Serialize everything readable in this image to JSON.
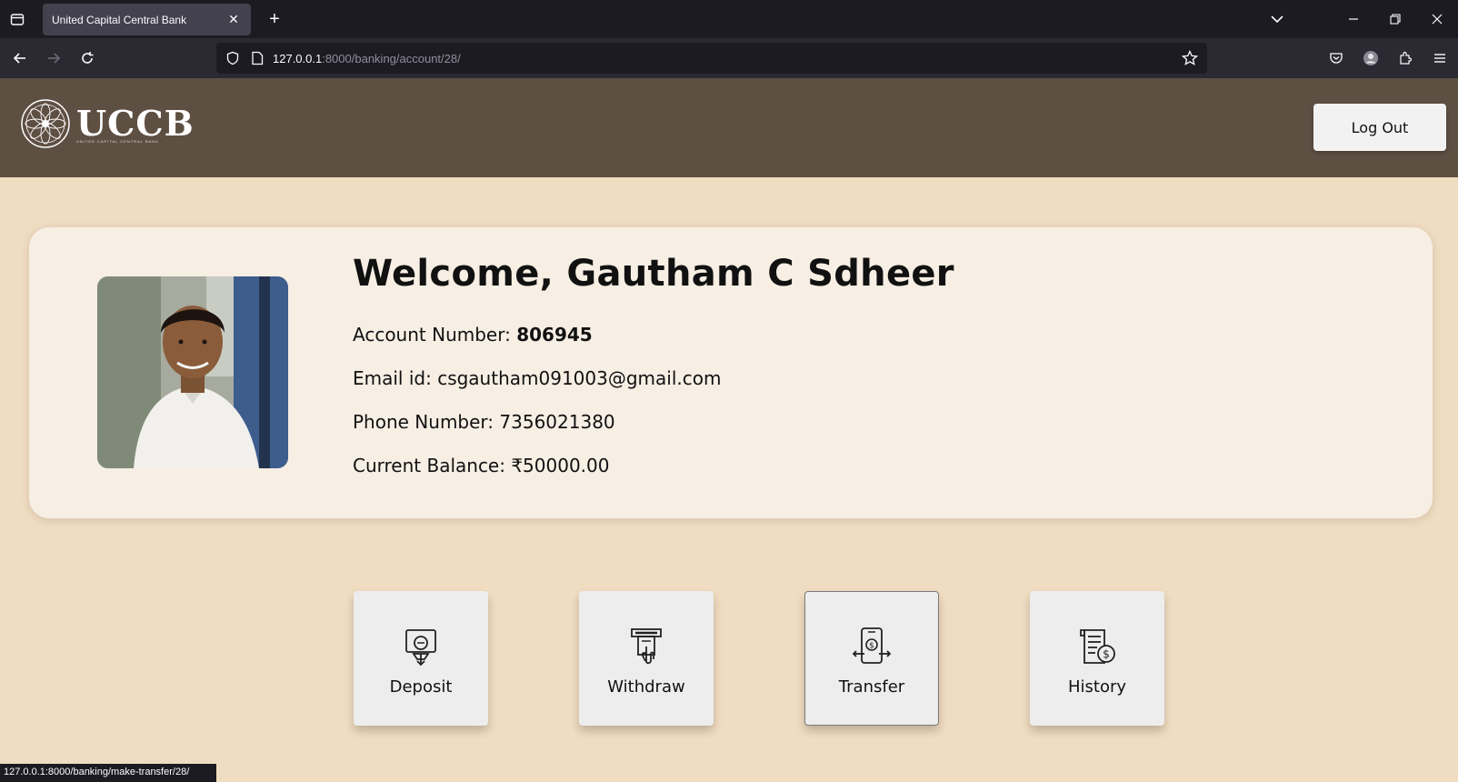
{
  "browser": {
    "tab_title": "United Capital Central Bank",
    "tab_close": "✕",
    "new_tab": "+",
    "url_host": "127.0.0.1",
    "url_path": ":8000/banking/account/28/",
    "status_url": "127.0.0.1:8000/banking/make-transfer/28/"
  },
  "header": {
    "logo_text": "UCCB",
    "logo_subtext": "UNITED CAPITAL CENTRAL BANK",
    "logout_label": "Log Out"
  },
  "profile": {
    "welcome": "Welcome, Gautham C Sdheer",
    "account_label": "Account Number: ",
    "account_number": "806945",
    "email": "Email id: csgautham091003@gmail.com",
    "phone": "Phone Number: 7356021380",
    "balance": "Current Balance: ₹50000.00"
  },
  "actions": [
    {
      "label": "Deposit",
      "icon": "deposit-icon"
    },
    {
      "label": "Withdraw",
      "icon": "withdraw-icon"
    },
    {
      "label": "Transfer",
      "icon": "transfer-icon"
    },
    {
      "label": "History",
      "icon": "history-icon"
    }
  ],
  "colors": {
    "page_bg": "#f0dcc0",
    "header_bg": "#5e4f43",
    "card_bg": "#f7eee4",
    "button_bg": "#ededed"
  }
}
